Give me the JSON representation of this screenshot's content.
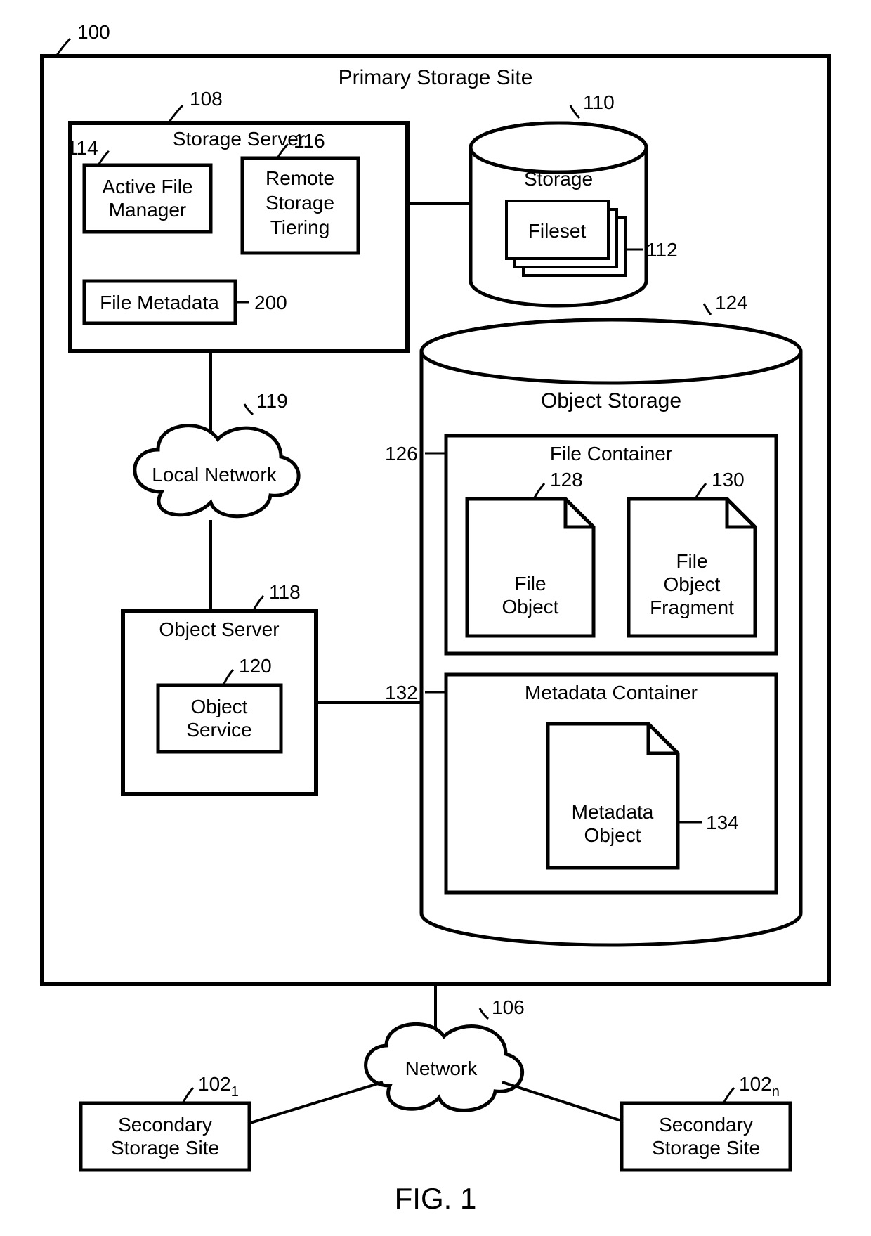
{
  "figure": "FIG. 1",
  "primary": {
    "title": "Primary Storage Site",
    "ref": "100"
  },
  "storage_server": {
    "title": "Storage Server",
    "ref": "108",
    "active_file_mgr": {
      "label_l1": "Active File",
      "label_l2": "Manager",
      "ref": "114"
    },
    "remote_tiering": {
      "label_l1": "Remote",
      "label_l2": "Storage",
      "label_l3": "Tiering",
      "ref": "116"
    },
    "file_metadata": {
      "label": "File Metadata",
      "ref": "200"
    }
  },
  "storage": {
    "title": "Storage",
    "ref": "110",
    "fileset": {
      "label": "Fileset",
      "ref": "112"
    }
  },
  "local_network": {
    "label": "Local Network",
    "ref": "119"
  },
  "object_server": {
    "title": "Object Server",
    "ref": "118",
    "object_service": {
      "label_l1": "Object",
      "label_l2": "Service",
      "ref": "120"
    }
  },
  "object_storage": {
    "title": "Object Storage",
    "ref": "124",
    "file_container": {
      "title": "File Container",
      "ref": "126",
      "file_object": {
        "label_l1": "File",
        "label_l2": "Object",
        "ref": "128"
      },
      "file_object_fragment": {
        "label_l1": "File",
        "label_l2": "Object",
        "label_l3": "Fragment",
        "ref": "130"
      }
    },
    "metadata_container": {
      "title": "Metadata Container",
      "ref": "132",
      "metadata_object": {
        "label_l1": "Metadata",
        "label_l2": "Object",
        "ref": "134"
      }
    }
  },
  "network": {
    "label": "Network",
    "ref": "106"
  },
  "secondary_left": {
    "label_l1": "Secondary",
    "label_l2": "Storage Site",
    "ref": "102",
    "sub": "1"
  },
  "secondary_right": {
    "label_l1": "Secondary",
    "label_l2": "Storage Site",
    "ref": "102",
    "sub": "n"
  }
}
